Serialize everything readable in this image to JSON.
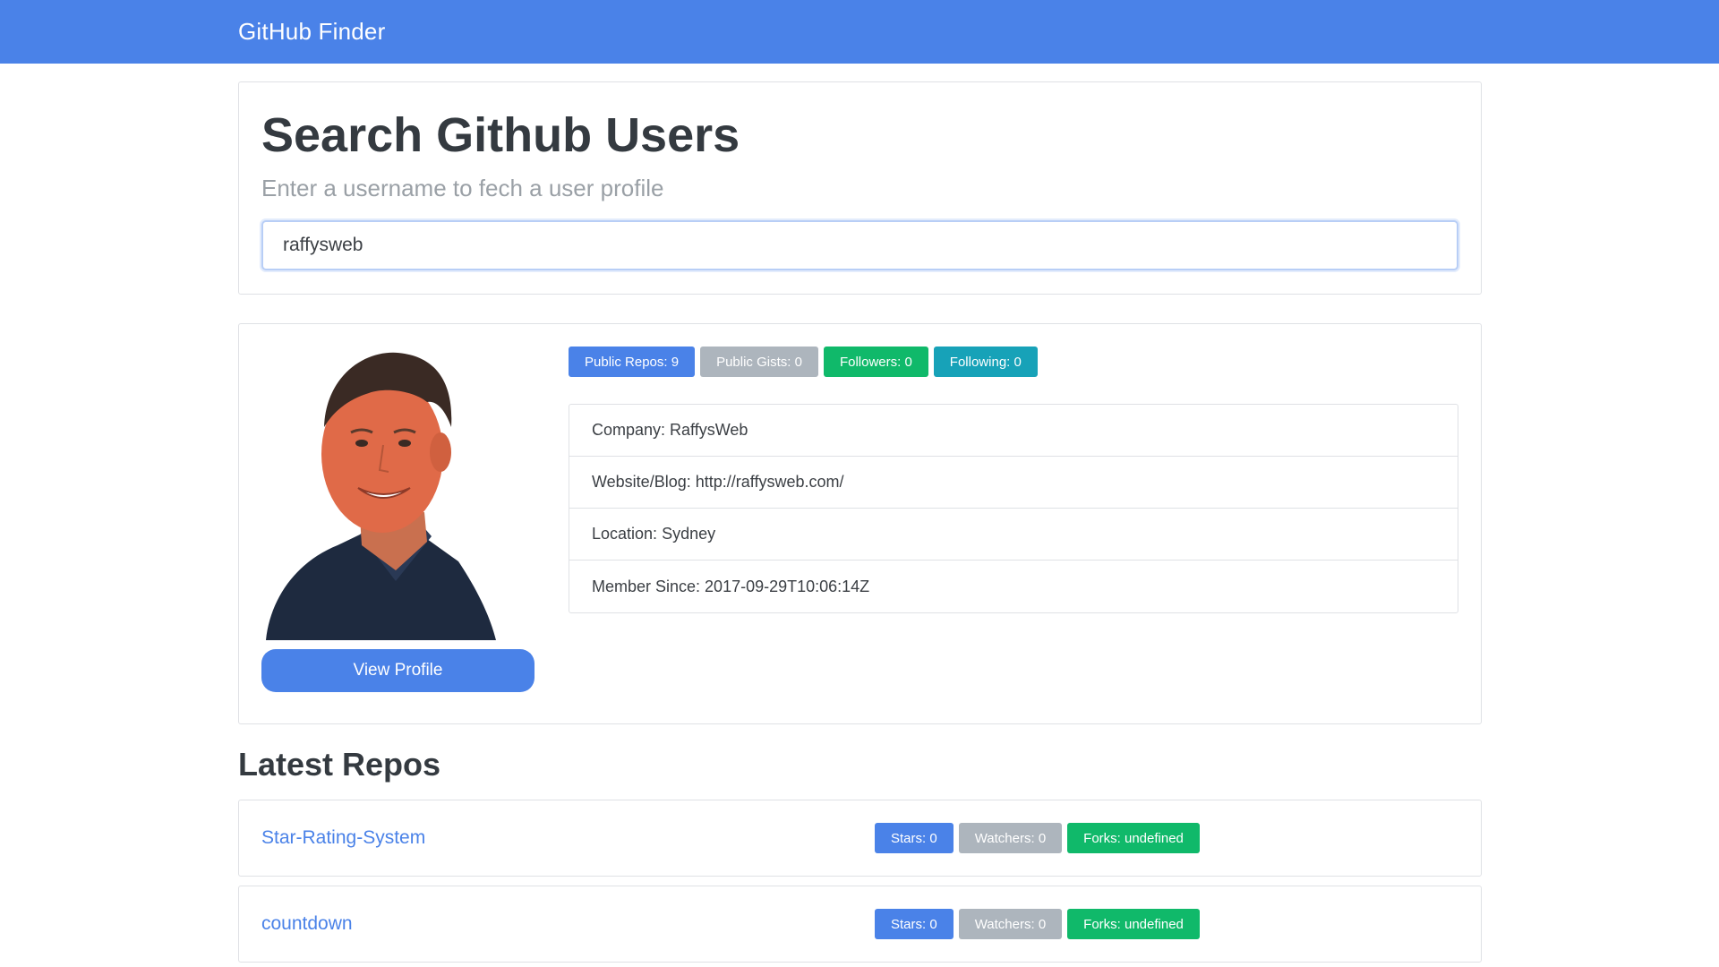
{
  "navbar": {
    "brand": "GitHub Finder"
  },
  "search": {
    "title": "Search Github Users",
    "lead": "Enter a username to fech a user profile",
    "input_value": "raffysweb"
  },
  "profile": {
    "view_profile_label": "View Profile",
    "badges": {
      "public_repos": "Public Repos: 9",
      "public_gists": "Public Gists: 0",
      "followers": "Followers: 0",
      "following": "Following: 0"
    },
    "info": {
      "company_label": "Company:",
      "company": "RaffysWeb",
      "website_label": "Website/Blog:",
      "website": "http://raffysweb.com/",
      "location_label": "Location:",
      "location": "Sydney",
      "member_since_label": "Member Since:",
      "member_since": "2017-09-29T10:06:14Z"
    }
  },
  "repos": {
    "title": "Latest Repos",
    "items": [
      {
        "name": "Star-Rating-System",
        "stars": "Stars: 0",
        "watchers": "Watchers: 0",
        "forks": "Forks: undefined"
      },
      {
        "name": "countdown",
        "stars": "Stars: 0",
        "watchers": "Watchers: 0",
        "forks": "Forks: undefined"
      }
    ]
  },
  "colors": {
    "primary": "#4a82e8",
    "secondary": "#adb5bd",
    "success": "#10b96a",
    "info": "#17a2b8"
  },
  "icons": {
    "avatar": "avatar-photo"
  }
}
